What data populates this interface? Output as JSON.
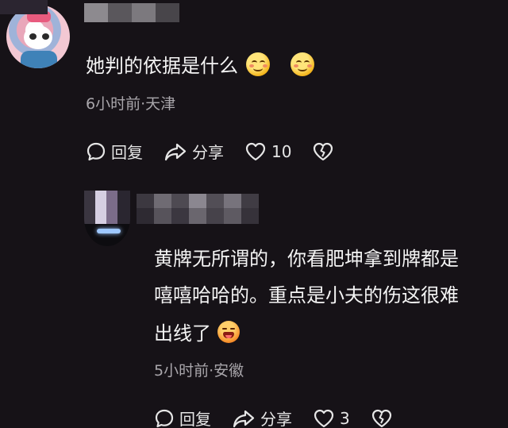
{
  "comments": [
    {
      "text": "她判的依据是什么",
      "emojis": [
        "grinning-face-icon",
        "grinning-face-icon"
      ],
      "time_location": "6小时前·天津",
      "actions": {
        "reply_label": "回复",
        "share_label": "分享",
        "likes": "10"
      }
    },
    {
      "lines": [
        "黄牌无所谓的，你看肥坤拿到牌都是",
        "嘻嘻哈哈的。重点是小夫的伤这很难",
        "出线了"
      ],
      "emojis": [
        "hot-face-icon"
      ],
      "time_location": "5小时前·安徽",
      "actions": {
        "reply_label": "回复",
        "share_label": "分享",
        "likes": "3"
      }
    }
  ],
  "colors": {
    "background": "#161217",
    "text": "#f4f4f4",
    "meta": "#a9a6ab",
    "icon": "#e6e6e6"
  }
}
